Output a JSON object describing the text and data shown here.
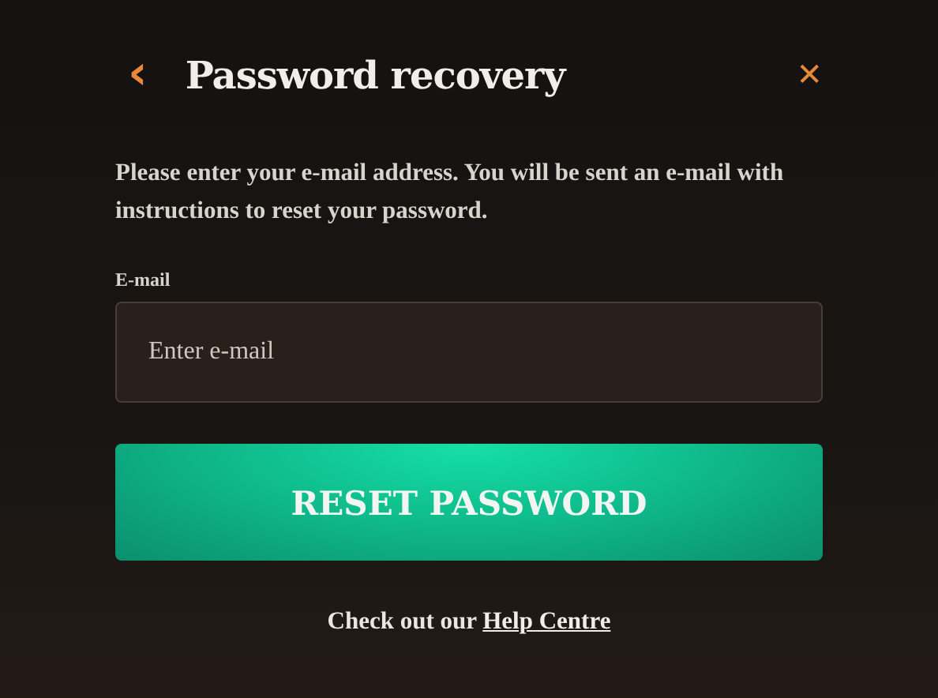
{
  "header": {
    "back": "‹",
    "title": "Password recovery",
    "close": "✕"
  },
  "description": "Please enter your e-mail address. You will be sent an e-mail with instructions to reset your password.",
  "email_field": {
    "label": "E-mail",
    "placeholder": "Enter e-mail"
  },
  "submit_button": "RESET PASSWORD",
  "footer": {
    "text": "Check out our ",
    "link": "Help Centre"
  }
}
